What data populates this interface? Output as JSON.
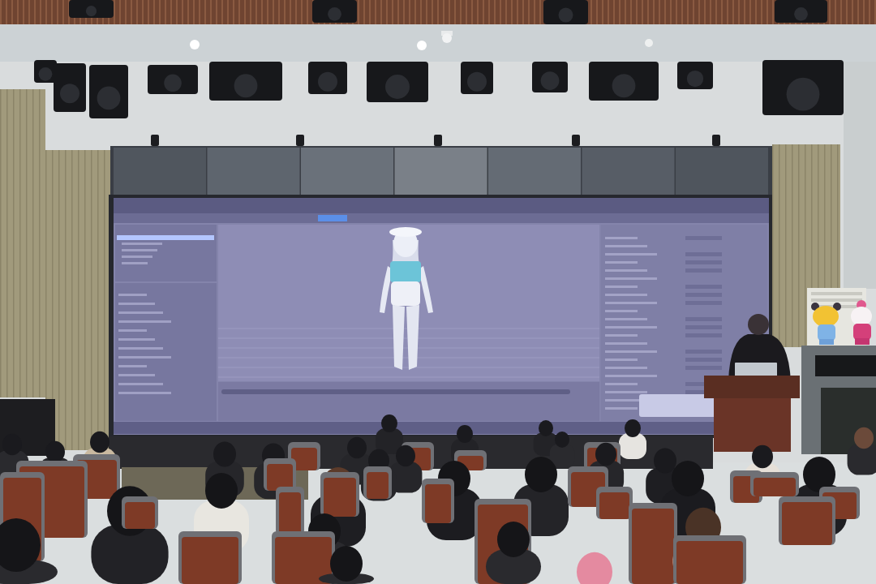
{
  "photo": {
    "kind": "lecture-hall"
  }
}
